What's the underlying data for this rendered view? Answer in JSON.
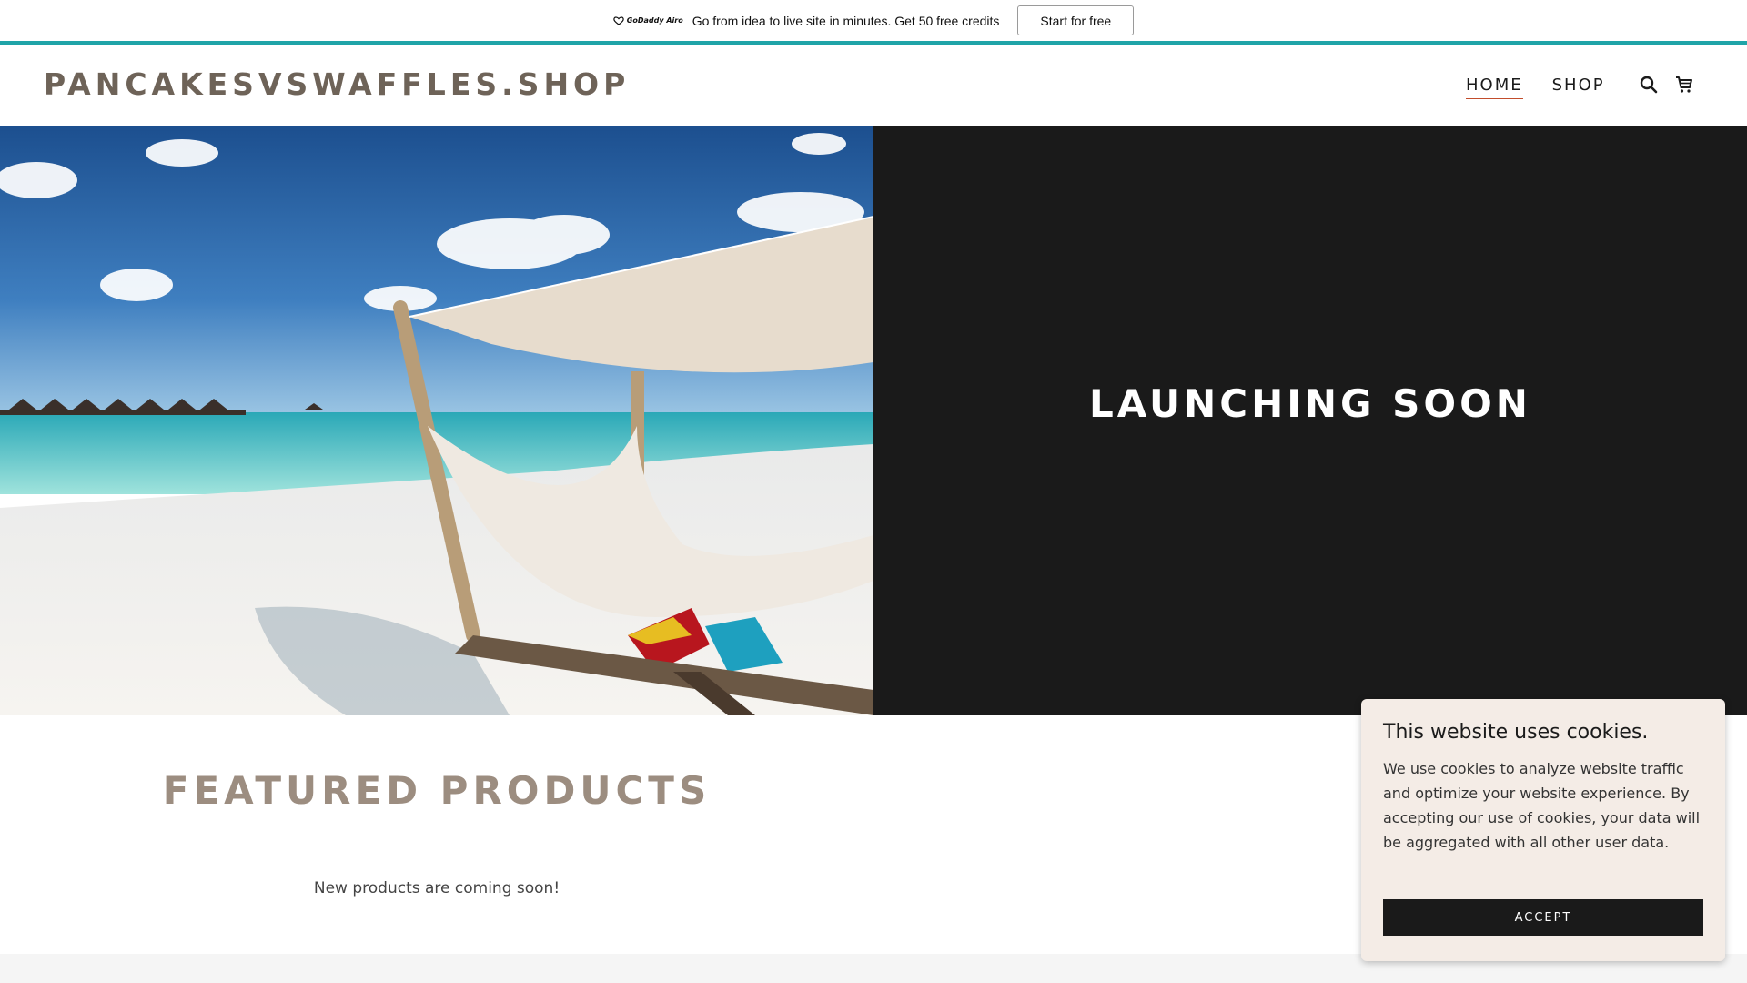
{
  "promo": {
    "logo_text": "GoDaddy Airo",
    "message": "Go from idea to live site in minutes. Get 50 free credits",
    "cta_label": "Start for free"
  },
  "header": {
    "site_name": "PANCAKESVSWAFFLES.SHOP",
    "nav": [
      {
        "label": "HOME",
        "active": true
      },
      {
        "label": "SHOP",
        "active": false
      }
    ],
    "icons": [
      "search-icon",
      "cart-icon"
    ]
  },
  "hero": {
    "image": "beach-hammock-photo",
    "headline": "LAUNCHING SOON"
  },
  "featured": {
    "title": "FEATURED PRODUCTS",
    "message": "New products are coming soon!"
  },
  "cookie_banner": {
    "title": "This website uses cookies.",
    "body": "We use cookies to analyze website traffic and optimize your website experience. By accepting our use of cookies, your data will be aggregated with all other user data.",
    "accept_label": "ACCEPT"
  },
  "colors": {
    "accent_rule": "#1fa4a8",
    "logo_text": "#6e6358",
    "featured_title": "#9c8d80",
    "hero_panel": "#1a1a1a",
    "cookie_bg": "#f4ece6",
    "nav_underline": "#c24d2c"
  }
}
